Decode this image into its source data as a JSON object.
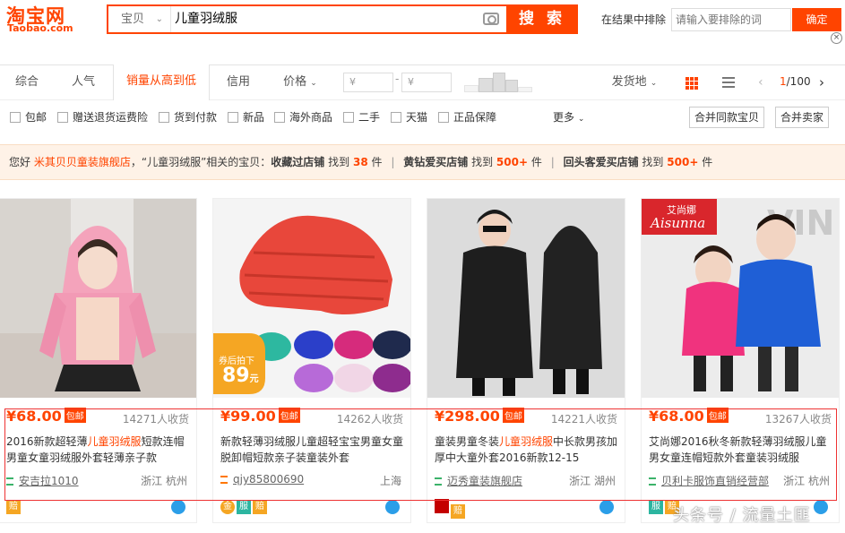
{
  "header": {
    "logo_cn": "淘宝网",
    "logo_en": "Taobao.com",
    "search_category": "宝贝",
    "search_query": "儿童羽绒服",
    "search_button": "搜 索",
    "exclude_label": "在结果中排除",
    "exclude_placeholder": "请输入要排除的词",
    "exclude_button": "确定"
  },
  "sortbar": {
    "tabs": [
      "综合",
      "人气",
      "销量从高到低",
      "信用",
      "价格"
    ],
    "active_tab": "销量从高到低",
    "price_min_placeholder": "¥",
    "price_max_placeholder": "¥",
    "price_dash": "-",
    "ship_from": "发货地",
    "page_current": "1",
    "page_total": "/100"
  },
  "filters": {
    "options": [
      "包邮",
      "赠送退货运费险",
      "货到付款",
      "新品",
      "海外商品",
      "二手",
      "天猫",
      "正品保障"
    ],
    "more": "更多",
    "merge_same": "合并同款宝贝",
    "merge_seller": "合并卖家"
  },
  "tips": {
    "greeting": "您好",
    "shop_name": "米其贝贝童装旗舰店",
    "query_part": "，“儿童羽绒服”相关的宝贝：",
    "g1_label": "收藏过店铺",
    "g1_pre": "找到",
    "g1_num": "38",
    "g1_unit": "件",
    "g2_label": "黄钻爱买店铺",
    "g2_pre": "找到",
    "g2_num": "500+",
    "g2_unit": "件",
    "g3_label": "回头客爱买店铺",
    "g3_pre": "找到",
    "g3_num": "500+",
    "g3_unit": "件",
    "separator": "|"
  },
  "products": [
    {
      "price": "¥68.00",
      "free_ship": "包邮",
      "sales": "14271人收货",
      "title_pre": "2016新款超轻薄",
      "title_kw": "儿童羽绒服",
      "title_post": "短款连帽男童女童羽绒服外套轻薄亲子款",
      "shop": "安吉拉1010",
      "location": "浙江 杭州"
    },
    {
      "price": "¥99.00",
      "free_ship": "包邮",
      "sales": "14262人收货",
      "title_pre": "新款轻薄羽绒服儿童超轻宝宝男童女童脱卸帽短款亲子装童装外套",
      "title_kw": "",
      "title_post": "",
      "shop": "qjy85800690",
      "location": "上海"
    },
    {
      "price": "¥298.00",
      "free_ship": "包邮",
      "sales": "14221人收货",
      "title_pre": "童装男童冬装",
      "title_kw": "儿童羽绒服",
      "title_post": "中长款男孩加厚中大童外套2016新款12-15",
      "shop": "迈秀童装旗舰店",
      "location": "浙江 湖州"
    },
    {
      "price": "¥68.00",
      "free_ship": "包邮",
      "sales": "13267人收货",
      "title_pre": "艾尚娜2016秋冬新款轻薄羽绒服儿童男女童连帽短款外套童装羽绒服",
      "title_kw": "",
      "title_post": "",
      "shop": "贝利卡服饰直销经营部",
      "location": "浙江 杭州"
    }
  ],
  "image_text": {
    "coupon_line1": "券后拍下",
    "coupon_price": "89",
    "coupon_unit": "元",
    "brand_logo_cn": "艾尚娜",
    "brand_logo_en": "Aisunna"
  },
  "badges": {
    "tmall_jin": "金",
    "fu": "服",
    "pei": "赔"
  },
  "watermark": "头条号 / 流量土匪",
  "colors": {
    "accent": "#ff4400",
    "highlight_box": "#e33333"
  }
}
